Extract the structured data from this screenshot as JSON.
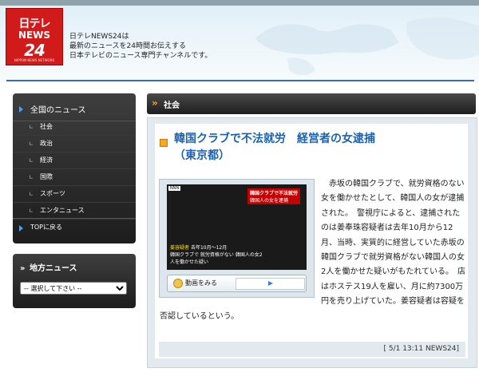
{
  "header": {
    "logo": {
      "line1": "日テレ",
      "line2": "NEWS",
      "line3": "24",
      "sub": "NIPPON NEWS NETWORK"
    },
    "tagline": [
      "日テレNEWS24は",
      "最新のニュースを24時間お伝えする",
      "日本テレビのニュース専門チャンネルです。"
    ]
  },
  "nav": {
    "heading": "全国のニュース",
    "items": [
      {
        "label": "社会"
      },
      {
        "label": "政治"
      },
      {
        "label": "経済"
      },
      {
        "label": "国際"
      },
      {
        "label": "スポーツ"
      },
      {
        "label": "エンタニュース"
      }
    ],
    "back": "TOPに戻る"
  },
  "regional": {
    "heading": "地方ニュース",
    "select_value": "-- 選択して下さい --"
  },
  "section": {
    "title": "社会"
  },
  "article": {
    "title_line1": "韓国クラブで不法就労　経営者の女逮捕",
    "title_line2": "（東京都）",
    "video": {
      "logo": "NNN",
      "banner_top": "韓国クラブで不法就労",
      "banner_bottom": "韓国人の女を逮捕",
      "caption_name": "姜容疑者",
      "caption_date": "去年10月～12月",
      "caption_text": "韓国クラブで 就労資格がない 韓国人の女2人を働かせた疑い"
    },
    "play_label": "動画をみる",
    "body": "　赤坂の韓国クラブで、就労資格のない女を働かせたとして、韓国人の女が逮捕された。　警視庁によると、逮捕されたのは姜奉珠容疑者は去年10月から12月、当時、実質的に経営していた赤坂の韓国クラブで就労資格がない韓国人の女2人を働かせた疑いがもたれている。　店はホステス19人を雇い、月に約7300万円を売り上げていた。姜容疑者は容疑を否認しているという。",
    "footer": "[ 5/1 13:11 NEWS24]"
  },
  "colors": {
    "accent": "#1b62b5",
    "brand": "#d11a1a",
    "orange": "#f5a623"
  }
}
